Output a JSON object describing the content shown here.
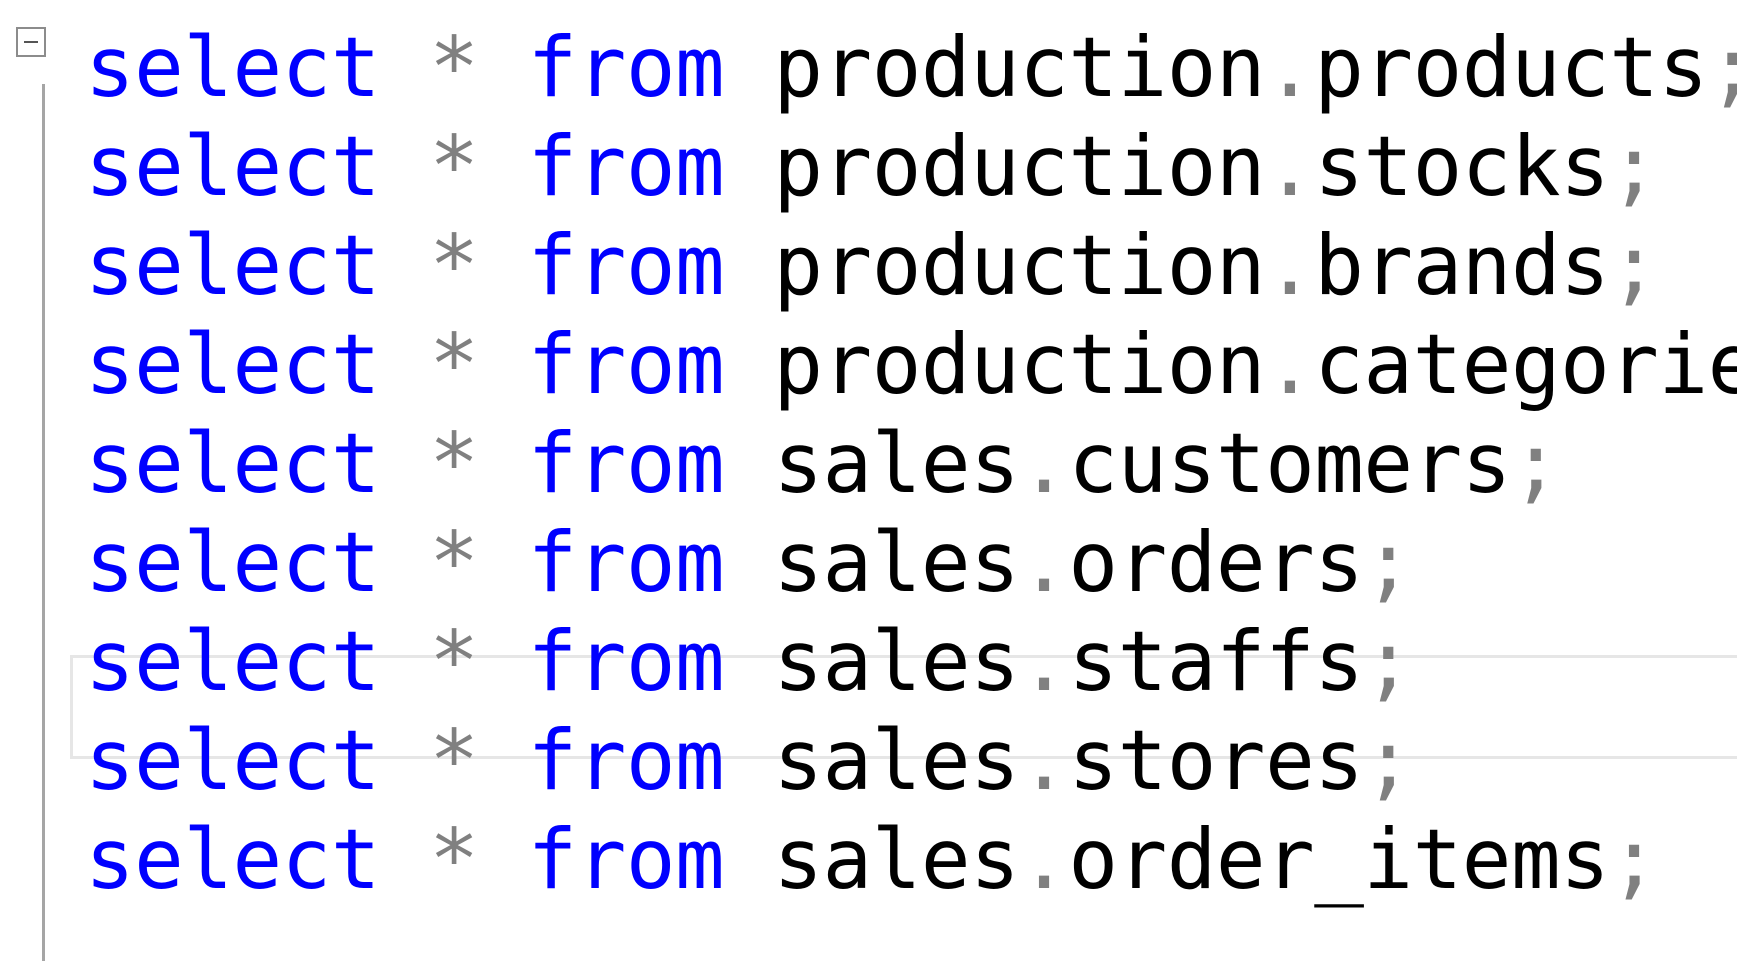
{
  "editor": {
    "lines": [
      {
        "select": "select",
        "star": "*",
        "from": "from",
        "target": "production.products",
        "semicolon": ";"
      },
      {
        "select": "select",
        "star": "*",
        "from": "from",
        "target": "production.stocks",
        "semicolon": ";"
      },
      {
        "select": "select",
        "star": "*",
        "from": "from",
        "target": "production.brands",
        "semicolon": ";"
      },
      {
        "select": "select",
        "star": "*",
        "from": "from",
        "target": "production.categories",
        "semicolon": ";"
      },
      {
        "select": "select",
        "star": "*",
        "from": "from",
        "target": "sales.customers",
        "semicolon": ";"
      },
      {
        "select": "select",
        "star": "*",
        "from": "from",
        "target": "sales.orders",
        "semicolon": ";"
      },
      {
        "select": "select",
        "star": "*",
        "from": "from",
        "target": "sales.staffs",
        "semicolon": ";"
      },
      {
        "select": "select",
        "star": "*",
        "from": "from",
        "target": "sales.stores",
        "semicolon": ";"
      },
      {
        "select": "select",
        "star": "*",
        "from": "from",
        "target": "sales.order_items",
        "semicolon": ";"
      }
    ],
    "current_line": 7,
    "fold_icon": "collapse-minus-icon",
    "colors": {
      "keyword": "#0000ff",
      "operator": "#808080",
      "identifier": "#000000",
      "current_line_border": "#e6e6e6",
      "gutter": "#a5a5a5"
    }
  }
}
